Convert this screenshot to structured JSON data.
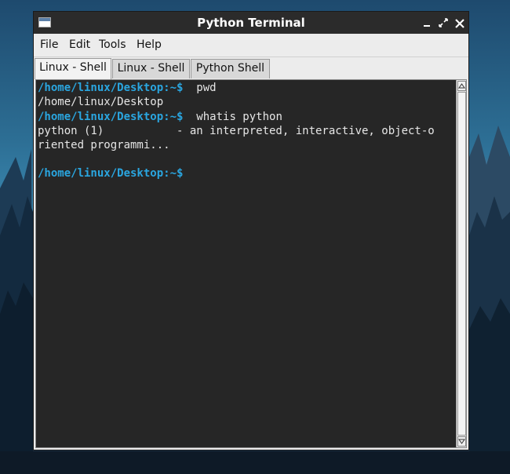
{
  "window": {
    "title": "Python Terminal",
    "minimize_glyph": "🗕",
    "maximize_glyph": "⤢",
    "close_glyph": "✕"
  },
  "menu": {
    "items": [
      "File",
      "Edit",
      "Tools",
      "Help"
    ]
  },
  "tabs": [
    {
      "label": "Linux - Shell",
      "active": true
    },
    {
      "label": "Linux - Shell",
      "active": false
    },
    {
      "label": "Python Shell",
      "active": false
    }
  ],
  "terminal": {
    "prompt": "/home/linux/Desktop:~$",
    "lines": [
      {
        "prompt": "/home/linux/Desktop:~$",
        "text": "  pwd"
      },
      {
        "prompt": "",
        "text": "/home/linux/Desktop"
      },
      {
        "prompt": "/home/linux/Desktop:~$",
        "text": "  whatis python"
      },
      {
        "prompt": "",
        "text": "python (1)           - an interpreted, interactive, object-o"
      },
      {
        "prompt": "",
        "text": "riented programmi..."
      },
      {
        "prompt": "",
        "text": ""
      },
      {
        "prompt": "/home/linux/Desktop:~$",
        "text": ""
      }
    ]
  },
  "scrollbar": {
    "up_glyph": "▲",
    "down_glyph": "▼"
  },
  "colors": {
    "titlebar": "#2b2b2b",
    "terminal_bg": "#262626",
    "prompt": "#2aa6e0",
    "terminal_text": "#e6e6e6"
  }
}
